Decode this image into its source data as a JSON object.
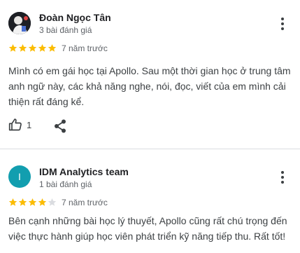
{
  "reviews": [
    {
      "author": "Đoàn Ngọc Tân",
      "meta": "3 bài đánh giá",
      "rating": 5,
      "date": "7 năm trước",
      "text": "Mình có em gái học tại Apollo. Sau một thời gian học ở trung tâm anh ngữ này, các khả năng nghe, nói, đọc, viết của em mình cải thiện rất đáng kể.",
      "likes": "1",
      "avatar_icon": "photo-avatar"
    },
    {
      "author": "IDM Analytics team",
      "meta": "1 bài đánh giá",
      "rating": 4,
      "date": "7 năm trước",
      "text": "Bên cạnh những bài học lý thuyết, Apollo cũng rất chú trọng đến việc thực hành giúp học viên phát triển kỹ năng tiếp thu. Rất tốt!",
      "avatar_letter": "I",
      "avatar_color": "#129eaf"
    }
  ],
  "colors": {
    "star_filled": "#fbbc04",
    "star_empty": "#dadce0",
    "divider": "#dadce0"
  },
  "icons": [
    "more-vert-icon",
    "thumb-up-icon",
    "share-icon",
    "star-icon"
  ]
}
